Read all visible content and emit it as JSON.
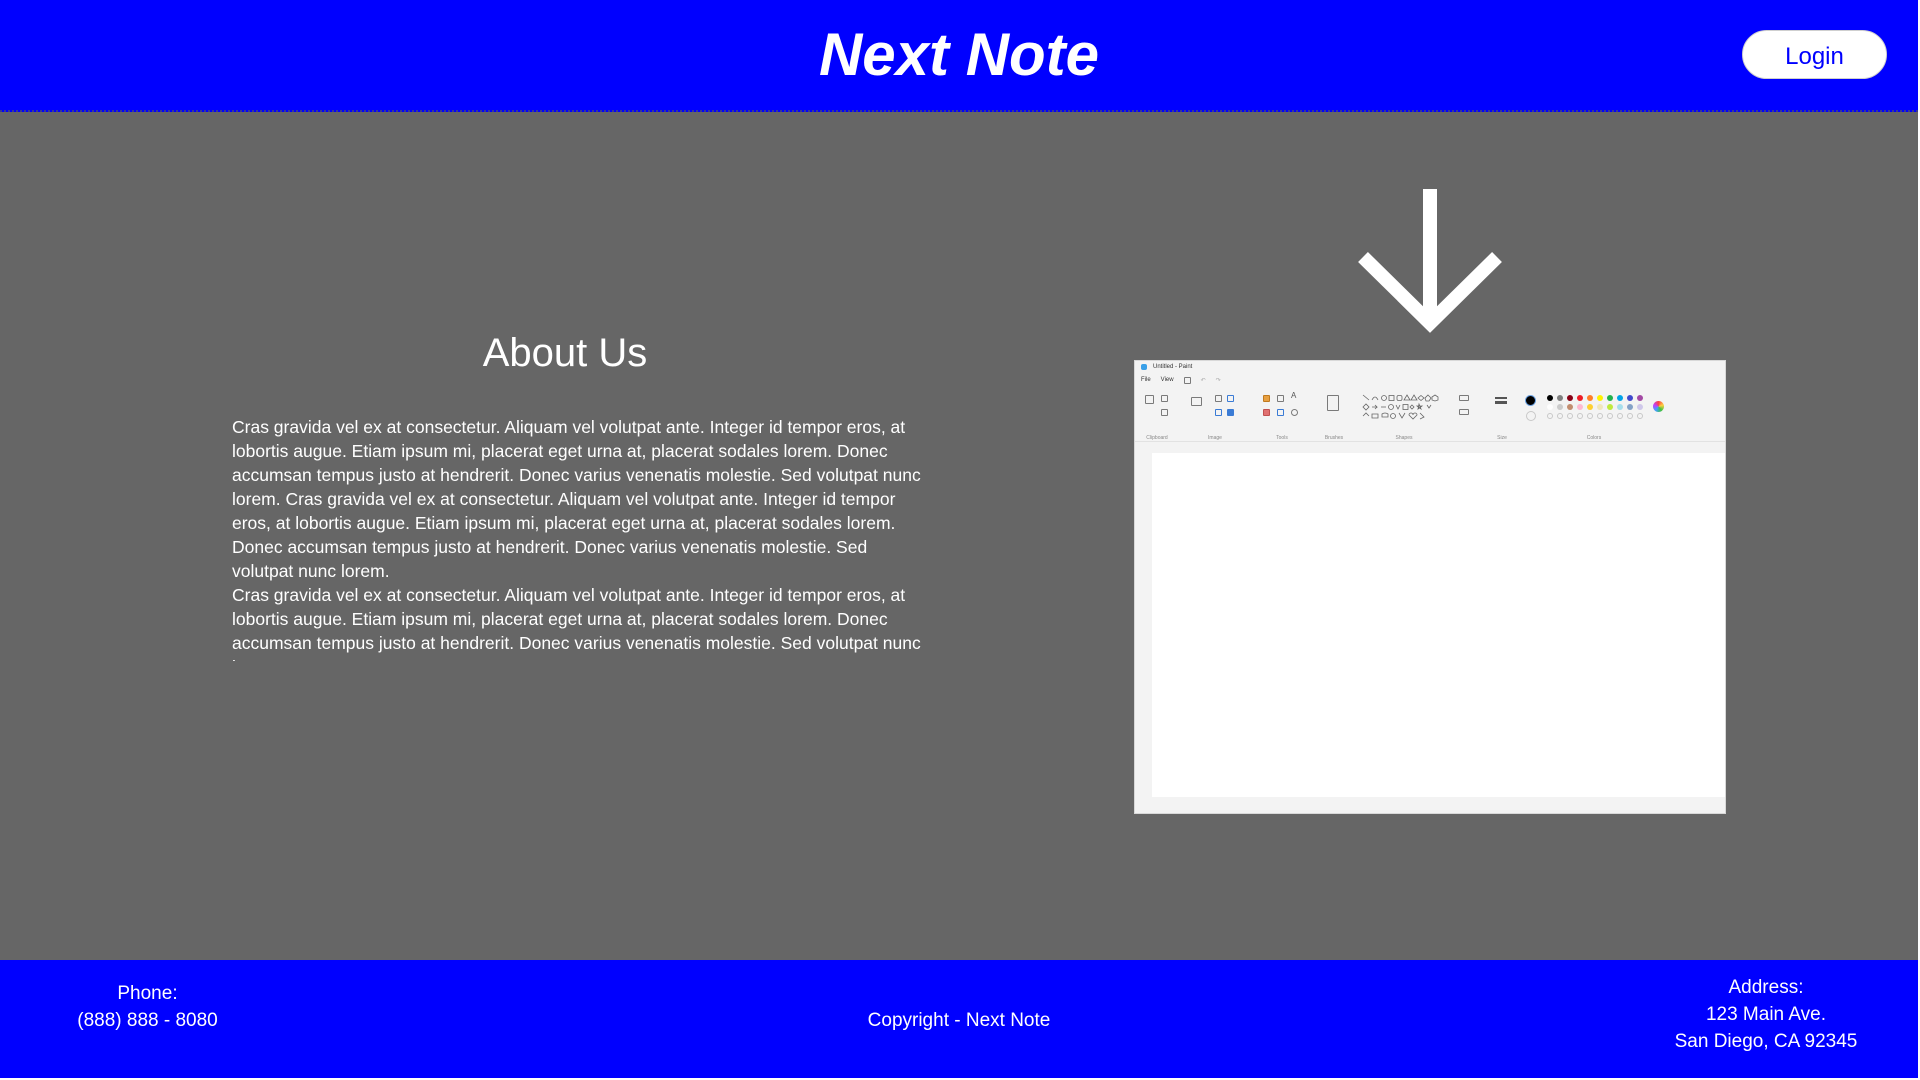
{
  "header": {
    "brand": "Next Note",
    "login_label": "Login"
  },
  "about": {
    "title": "About Us",
    "paragraphs": [
      "Cras gravida vel ex at consectetur. Aliquam vel volutpat ante. Integer id tempor eros, at lobortis augue. Etiam ipsum mi, placerat eget urna at, placerat sodales lorem. Donec accumsan tempus justo at hendrerit. Donec varius venenatis molestie. Sed volutpat nunc lorem. Cras gravida vel ex at consectetur. Aliquam vel volutpat ante. Integer id tempor eros, at lobortis augue. Etiam ipsum mi, placerat eget urna at, placerat sodales lorem. Donec accumsan tempus justo at hendrerit. Donec varius venenatis molestie. Sed volutpat nunc lorem.",
      " Cras gravida vel ex at consectetur. Aliquam vel volutpat ante. Integer id tempor eros, at lobortis augue. Etiam ipsum mi, placerat eget urna at, placerat sodales lorem. Donec accumsan tempus justo at hendrerit. Donec varius venenatis molestie. Sed volutpat nunc lorem."
    ]
  },
  "preview": {
    "window_title": "Untitled - Paint",
    "menu": [
      "File",
      "View"
    ],
    "groups": [
      "Clipboard",
      "Image",
      "Tools",
      "Brushes",
      "Shapes",
      "Size",
      "Colors"
    ],
    "palette": [
      "#000000",
      "#7f7f7f",
      "#880015",
      "#ed1c24",
      "#ff7f27",
      "#fff200",
      "#22b14c",
      "#00a2e8",
      "#3f48cc",
      "#a349a4"
    ],
    "palette_row2": [
      "#ffffff",
      "#c3c3c3",
      "#b97a57",
      "#ffaec9",
      "#ffc90e",
      "#efe4b0",
      "#b5e61d",
      "#99d9ea",
      "#7092be",
      "#c8bfe7"
    ]
  },
  "footer": {
    "phone_label": "Phone:",
    "phone_number": "(888) 888 - 8080",
    "copyright": "Copyright - Next Note",
    "address_label": "Address:",
    "address_line1": "123 Main Ave.",
    "address_line2": "San Diego, CA 92345"
  },
  "colors": {
    "primary": "#0000ff",
    "background": "#666666",
    "text_light": "#ffffff"
  },
  "icons": {
    "download_arrow": "arrow-down-icon"
  }
}
